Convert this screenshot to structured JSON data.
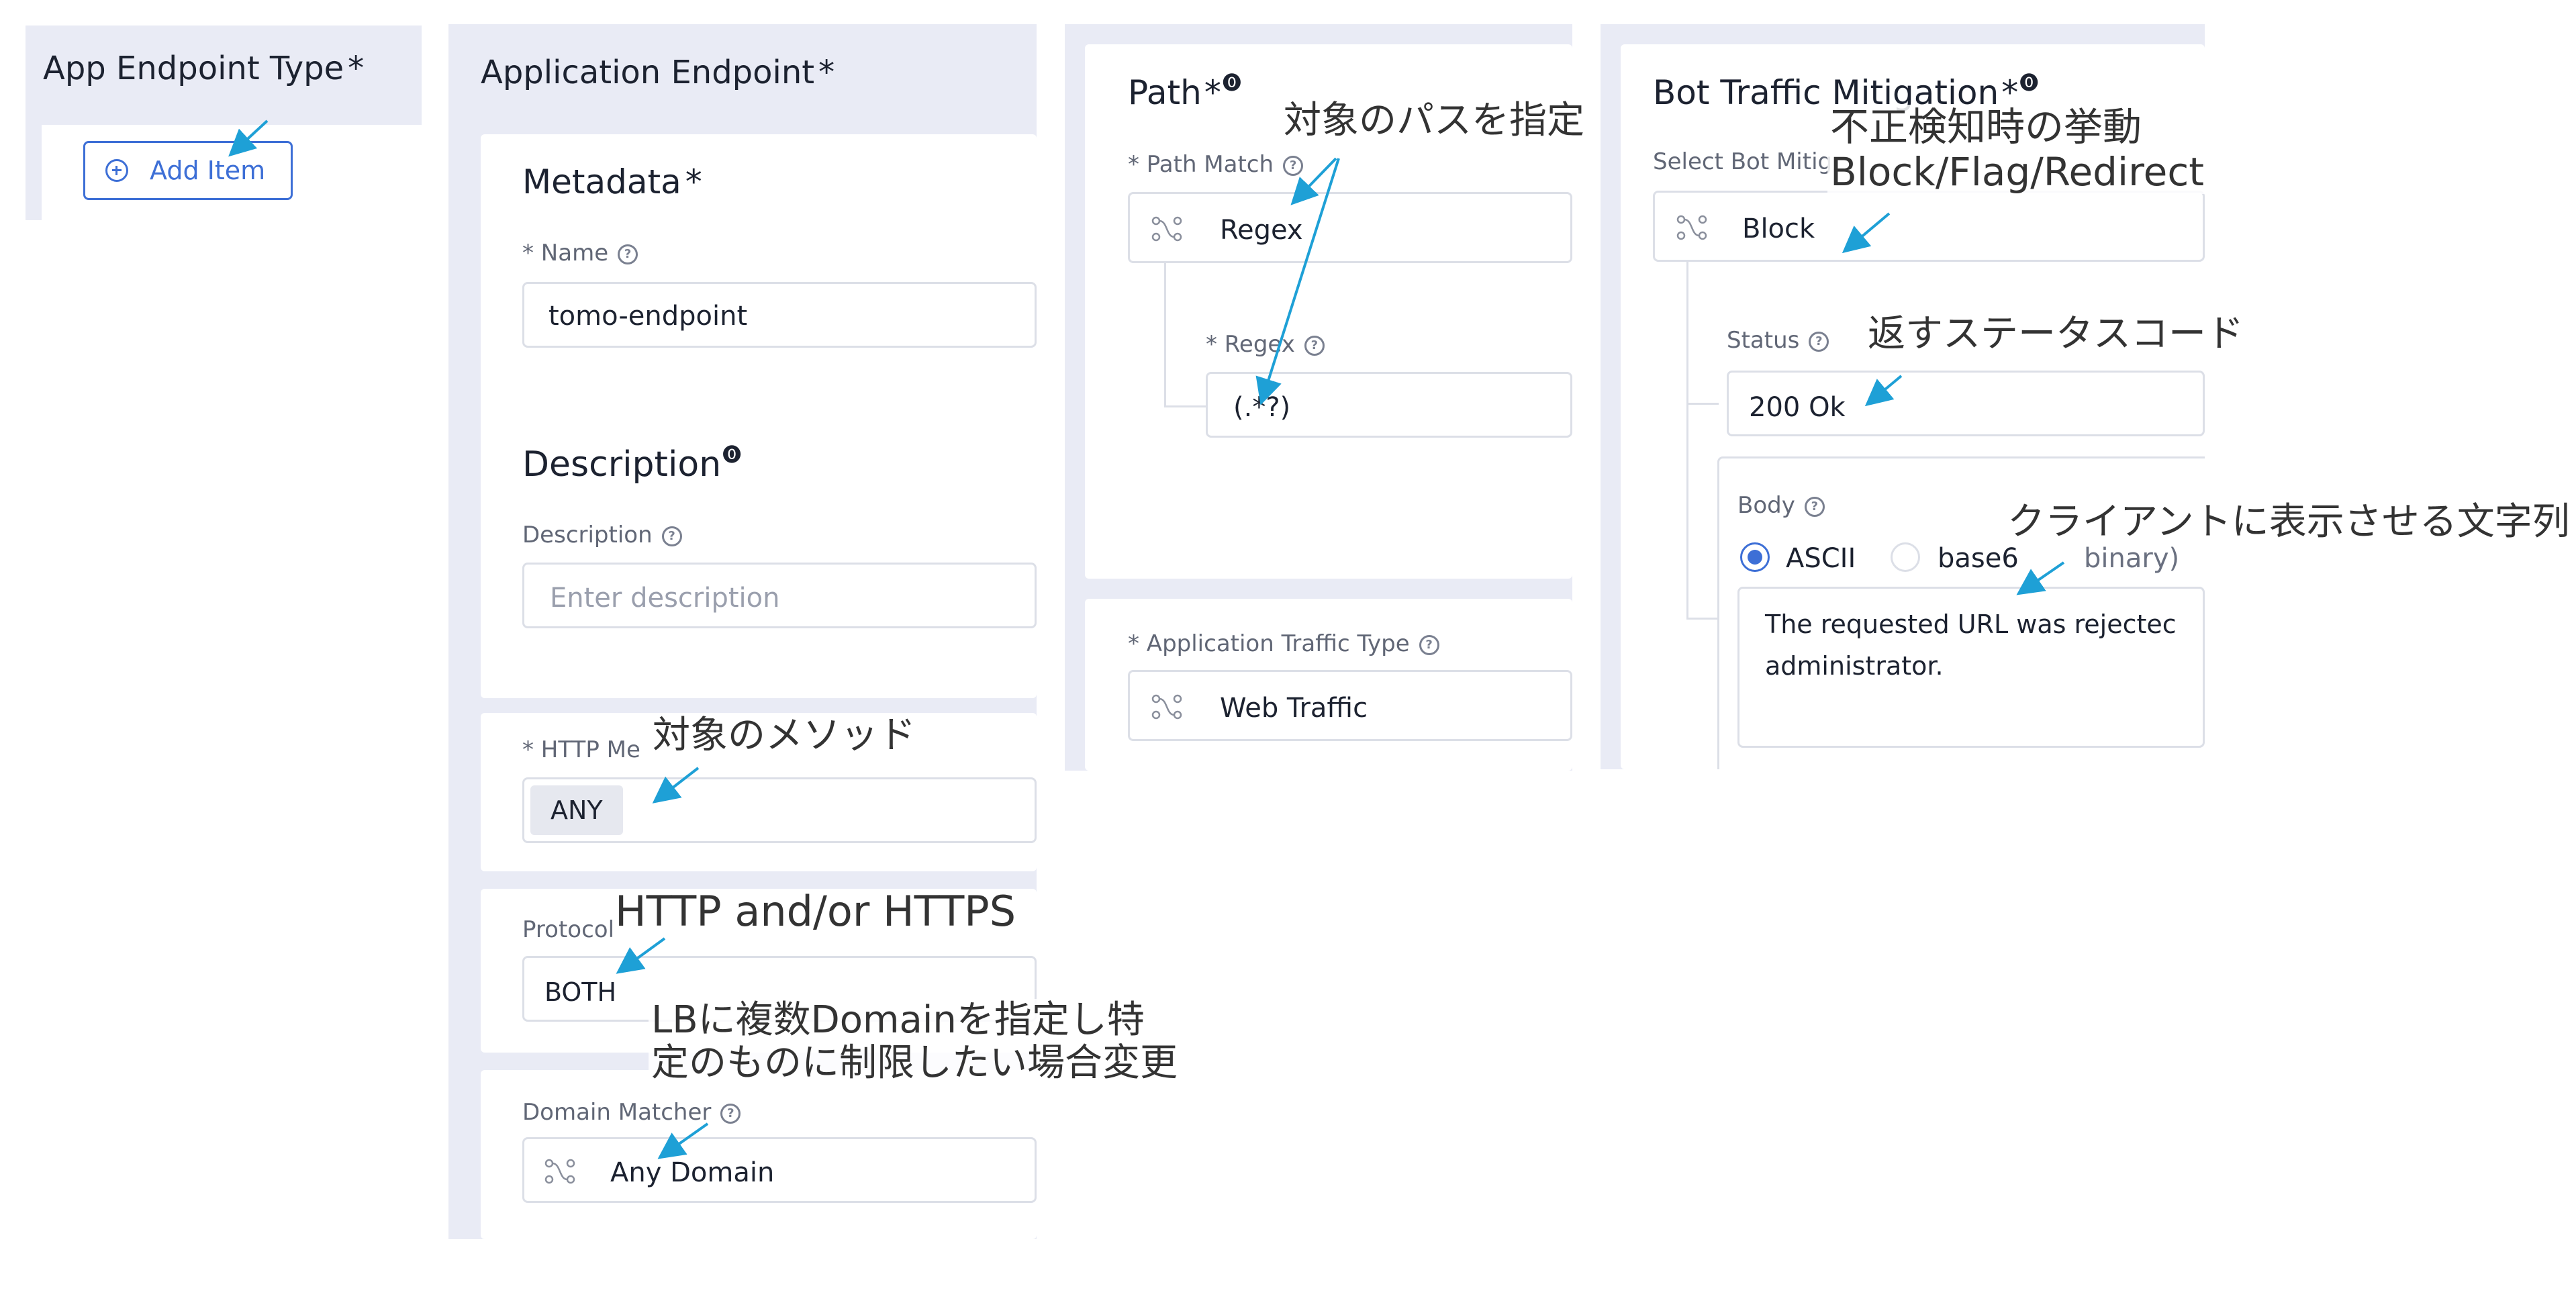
{
  "app_endpoint_panel": {
    "title": "App Endpoint Type",
    "required": "*",
    "add_item_label": "Add Item"
  },
  "application_endpoint_panel": {
    "title": "Application Endpoint",
    "required": "*",
    "metadata_title": "Metadata",
    "metadata_required": "*",
    "name_label": "* Name",
    "name_value": "tomo-endpoint",
    "description_title": "Description",
    "description_label": "Description",
    "description_placeholder": "Enter description",
    "http_method_label": "* HTTP Me",
    "http_method_value": "ANY",
    "protocol_label": "Protocol",
    "protocol_value": "BOTH",
    "domain_matcher_label": "Domain Matcher",
    "domain_matcher_value": "Any Domain"
  },
  "path_panel": {
    "title": "Path",
    "required": "*",
    "path_match_label": "* Path Match",
    "path_match_value": "Regex",
    "regex_label": "* Regex",
    "regex_value": "(.*?)",
    "traffic_type_label": "* Application Traffic Type",
    "traffic_type_value": "Web Traffic"
  },
  "bot_panel": {
    "title": "Bot Traffic Mitigation",
    "required": "*",
    "select_label": "Select Bot Mitig",
    "select_value": "Block",
    "status_label": "Status",
    "status_value": "200 Ok",
    "body_label": "Body",
    "radio_ascii": "ASCII",
    "radio_base64": "base6",
    "radio_base64_tail": "binary)",
    "body_text_line1": "The requested URL was rejectec",
    "body_text_line2": "administrator."
  },
  "annotations": {
    "path_target": "対象のパスを指定",
    "bot_behavior_line1": "不正検知時の挙動",
    "bot_behavior_line2": "Block/Flag/Redirect",
    "status_code": "返すステータスコード",
    "client_text": "クライアントに表示させる文字列",
    "method_target": "対象のメソッド",
    "protocol_note": "HTTP and/or HTTPS",
    "domain_note_line1": "LBに複数Domainを指定し特",
    "domain_note_line2": "定のものに制限したい場合変更"
  },
  "colors": {
    "panel_bg": "#e9ebf5",
    "accent_blue": "#3d6fd6",
    "annotation_arrow": "#1ea0d6",
    "radio_selected": "#3d6fd6"
  },
  "icons": {
    "add": "plus-circle-icon",
    "selector": "shuffle-nodes-icon",
    "help": "help-circle-icon"
  }
}
